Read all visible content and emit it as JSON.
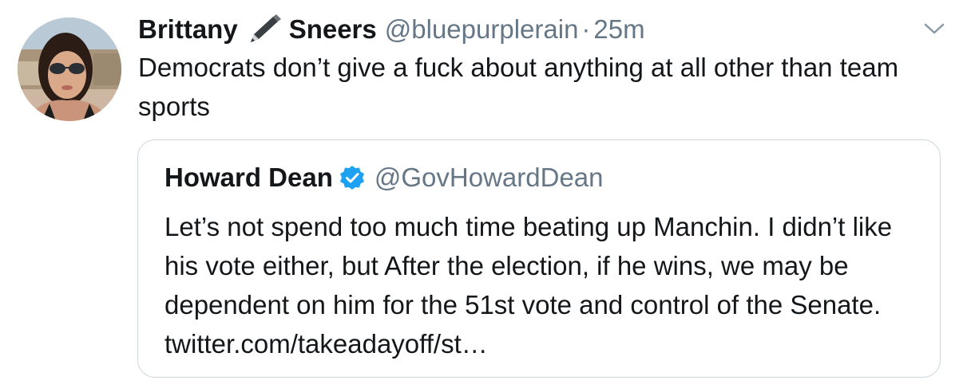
{
  "tweet": {
    "display_name_first": "Brittany",
    "display_name_last": "Sneers",
    "name_emoji_icon": "pen-icon",
    "handle": "@bluepurplerain",
    "separator": "·",
    "time": "25m",
    "text": "Democrats don’t give a fuck about anything at all other than team sports",
    "menu_icon": "chevron-down-icon"
  },
  "quote": {
    "name": "Howard Dean",
    "verified_icon": "verified-badge-icon",
    "handle": "@GovHowardDean",
    "text": "Let’s not spend too much time beating up Manchin. I didn’t like his vote either, but After the election, if he wins, we may be dependent on him for the 51st vote and control of the Senate. twitter.com/takeadayoff/st…"
  },
  "colors": {
    "text": "#14171a",
    "secondary": "#657786",
    "border": "#ccd6dd",
    "verified": "#1da1f2"
  }
}
